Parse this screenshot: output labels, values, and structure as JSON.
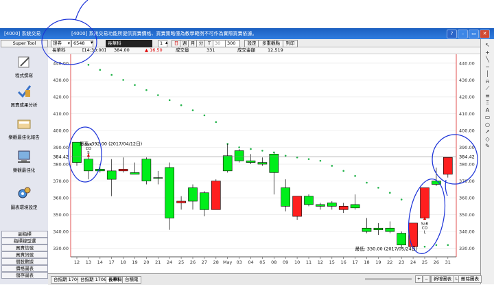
{
  "window": {
    "app_title": "[4000] 系統交易",
    "message": "[4000] 系統交易功能所提供買賣價格、買賣策略僅為教學範例不可作為實際買賣依據。",
    "help_label": "?"
  },
  "sidebar": {
    "header": "Super Tool",
    "tools": [
      {
        "label": "程式撰寫",
        "icon": "edit-icon"
      },
      {
        "label": "買賣成果分析",
        "icon": "checkmark-icon"
      },
      {
        "label": "樂觀最佳化報告",
        "icon": "report-icon"
      },
      {
        "label": "樂觀最佳化",
        "icon": "computer-icon"
      },
      {
        "label": "圖表環境設定",
        "icon": "gears-icon"
      }
    ],
    "buttons": [
      "副指標",
      "指標線型選",
      "買賣信號",
      "買賣訊號",
      "個股數據",
      "價格圖表",
      "儲存圖表"
    ]
  },
  "toolbar": {
    "market_select": "證券",
    "symbol_input": "6548",
    "symbol_name": "長華科",
    "period_value": "1",
    "period_buttons": [
      "日",
      "週",
      "月",
      "分"
    ],
    "tick_label": "T",
    "tick_select": "30",
    "count_input": "300",
    "settings_label": "設定",
    "multi_label": "多重觀點",
    "print_label": "列印"
  },
  "inforow": {
    "name": "長華科",
    "time": "[14:30:00]",
    "price": "384.00",
    "change": "▲ 16.50",
    "volume_label": "成交量",
    "volume": "331",
    "amount_label": "成交金額",
    "amount": "12,519"
  },
  "chart_data": {
    "type": "candlestick",
    "ylim": [
      327,
      442
    ],
    "y_ticks": [
      330,
      340,
      350,
      360,
      370,
      380,
      390,
      400,
      410,
      420,
      430,
      440
    ],
    "y_tick_labels": [
      "330.00",
      "340.00",
      "350.00",
      "360.00",
      "370.00",
      "380.00",
      "390.00",
      "400.00",
      "410.00",
      "420.00",
      "430.00",
      "440.00"
    ],
    "x_tick_labels": [
      "12",
      "13",
      "14",
      "17",
      "18",
      "19",
      "20",
      "21",
      "24",
      "25",
      "26",
      "27",
      "28",
      "May",
      "03",
      "04",
      "05",
      "08",
      "09",
      "10",
      "11",
      "12",
      "15",
      "16",
      "17",
      "18",
      "19",
      "22",
      "23",
      "24",
      "25",
      "26",
      "31"
    ],
    "current_price_label": "384.42",
    "current_price": 384.42,
    "candles": [
      {
        "o": 381,
        "h": 393,
        "l": 379,
        "c": 393,
        "color": "green"
      },
      {
        "o": 383,
        "h": 385,
        "l": 371,
        "c": 376,
        "color": "green"
      },
      {
        "o": 377,
        "h": 380,
        "l": 375,
        "c": 376,
        "color": "green"
      },
      {
        "o": 376,
        "h": 383,
        "l": 361,
        "c": 371,
        "color": "green"
      },
      {
        "o": 376,
        "h": 384,
        "l": 375,
        "c": 377,
        "color": "red"
      },
      {
        "o": 374,
        "h": 381,
        "l": 374,
        "c": 375,
        "color": "green"
      },
      {
        "o": 383,
        "h": 384,
        "l": 368,
        "c": 370,
        "color": "green"
      },
      {
        "o": 372,
        "h": 376,
        "l": 368,
        "c": 372,
        "color": "green"
      },
      {
        "o": 378,
        "h": 381,
        "l": 341,
        "c": 348,
        "color": "green"
      },
      {
        "o": 357,
        "h": 361,
        "l": 353,
        "c": 358,
        "color": "red"
      },
      {
        "o": 366,
        "h": 368,
        "l": 353,
        "c": 358,
        "color": "green"
      },
      {
        "o": 363,
        "h": 364,
        "l": 349,
        "c": 353,
        "color": "green"
      },
      {
        "o": 353,
        "h": 371,
        "l": 353,
        "c": 370,
        "color": "red"
      },
      {
        "o": 385,
        "h": 392,
        "l": 375,
        "c": 376,
        "color": "green"
      },
      {
        "o": 388,
        "h": 389,
        "l": 381,
        "c": 382,
        "color": "green"
      },
      {
        "o": 382,
        "h": 386,
        "l": 380,
        "c": 381,
        "color": "green"
      },
      {
        "o": 381,
        "h": 384,
        "l": 379,
        "c": 380,
        "color": "green"
      },
      {
        "o": 386,
        "h": 387,
        "l": 362,
        "c": 375,
        "color": "green"
      },
      {
        "o": 366,
        "h": 371,
        "l": 352,
        "c": 355,
        "color": "green"
      },
      {
        "o": 349,
        "h": 361,
        "l": 347,
        "c": 361,
        "color": "red"
      },
      {
        "o": 361,
        "h": 362,
        "l": 355,
        "c": 356,
        "color": "green"
      },
      {
        "o": 356,
        "h": 357,
        "l": 353,
        "c": 355,
        "color": "green"
      },
      {
        "o": 357,
        "h": 358,
        "l": 353,
        "c": 355,
        "color": "green"
      },
      {
        "o": 353,
        "h": 357,
        "l": 351,
        "c": 355,
        "color": "red"
      },
      {
        "o": 356,
        "h": 362,
        "l": 353,
        "c": 354,
        "color": "green"
      },
      {
        "o": 342,
        "h": 348,
        "l": 339,
        "c": 340,
        "color": "green"
      },
      {
        "o": 342,
        "h": 345,
        "l": 338,
        "c": 341,
        "color": "green"
      },
      {
        "o": 342,
        "h": 346,
        "l": 339,
        "c": 340,
        "color": "green"
      },
      {
        "o": 339,
        "h": 340,
        "l": 330,
        "c": 332,
        "color": "green"
      },
      {
        "o": 331,
        "h": 345,
        "l": 330,
        "c": 345,
        "color": "red"
      },
      {
        "o": 348,
        "h": 366,
        "l": 347,
        "c": 366,
        "color": "red"
      },
      {
        "o": 368,
        "h": 378,
        "l": 367,
        "c": 370,
        "color": "green"
      },
      {
        "o": 374,
        "h": 384,
        "l": 372,
        "c": 384,
        "color": "red"
      }
    ],
    "sar_dots": [
      {
        "i": 0,
        "v": 388
      },
      {
        "i": 1,
        "v": 439
      },
      {
        "i": 2,
        "v": 436
      },
      {
        "i": 3,
        "v": 433
      },
      {
        "i": 4,
        "v": 430
      },
      {
        "i": 5,
        "v": 427
      },
      {
        "i": 6,
        "v": 424
      },
      {
        "i": 7,
        "v": 421
      },
      {
        "i": 8,
        "v": 418
      },
      {
        "i": 9,
        "v": 415
      },
      {
        "i": 10,
        "v": 412
      },
      {
        "i": 11,
        "v": 409
      },
      {
        "i": 12,
        "v": 405
      },
      {
        "i": 13,
        "v": 392
      },
      {
        "i": 14,
        "v": 390
      },
      {
        "i": 15,
        "v": 389
      },
      {
        "i": 16,
        "v": 388
      },
      {
        "i": 17,
        "v": 387
      },
      {
        "i": 18,
        "v": 385
      },
      {
        "i": 19,
        "v": 384
      },
      {
        "i": 20,
        "v": 383
      },
      {
        "i": 21,
        "v": 382
      },
      {
        "i": 22,
        "v": 379
      },
      {
        "i": 23,
        "v": 376
      },
      {
        "i": 24,
        "v": 373
      },
      {
        "i": 25,
        "v": 369
      },
      {
        "i": 26,
        "v": 366
      },
      {
        "i": 27,
        "v": 363
      },
      {
        "i": 28,
        "v": 359
      },
      {
        "i": 29,
        "v": 337
      },
      {
        "i": 30,
        "v": 331
      },
      {
        "i": 31,
        "v": 332
      },
      {
        "i": 32,
        "v": 332
      }
    ],
    "annotations": {
      "high_label": "最高: 392.00 (2017/04/12日)",
      "low_label": "最低: 330.00 (2017/05/24日)",
      "signal_top": [
        "SaR",
        "CO",
        "S"
      ],
      "signal_bottom": [
        "SaR",
        "CO",
        "L"
      ]
    }
  },
  "bottombar": {
    "tabs": [
      "台指期 1706",
      "台指期 1706",
      "長華科",
      "台積電"
    ],
    "new_chart": "新增圖表",
    "delete_chart": "刪除圖表"
  },
  "right_tools": [
    "cursor-icon",
    "crosshair-icon",
    "line-icon",
    "hline-icon",
    "vline-icon",
    "bell-icon",
    "fan-icon",
    "channel-icon",
    "fib-icon",
    "text-icon",
    "rect-icon",
    "ellipse-icon",
    "arrow-icon",
    "eraser-icon",
    "pen-icon"
  ]
}
